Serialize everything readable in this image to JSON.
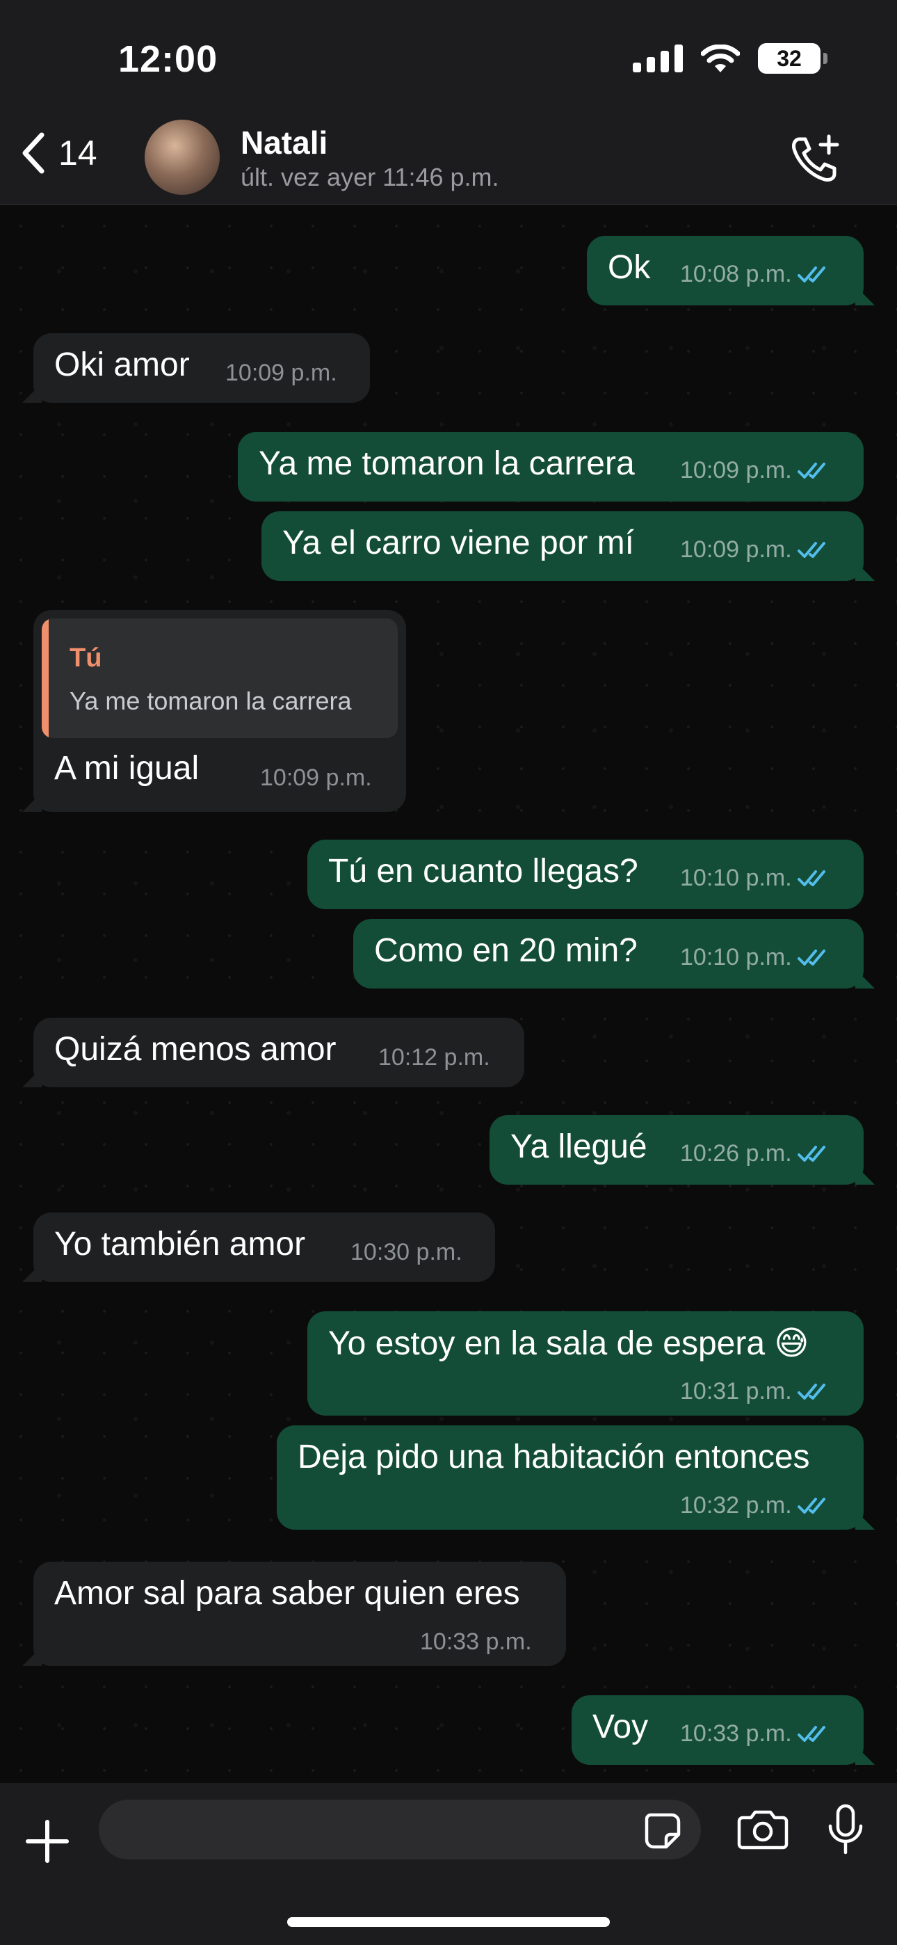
{
  "status_bar": {
    "time": "12:00",
    "battery": "32"
  },
  "header": {
    "back_count": "14",
    "contact_name": "Natali",
    "last_seen": "últ. vez ayer 11:46 p.m."
  },
  "messages": [
    {
      "direction": "out",
      "text": "Ok",
      "time": "10:08 p.m.",
      "read": true
    },
    {
      "direction": "in",
      "text": "Oki amor",
      "time": "10:09 p.m."
    },
    {
      "direction": "out",
      "text": "Ya me tomaron la carrera",
      "time": "10:09 p.m.",
      "read": true
    },
    {
      "direction": "out",
      "text": "Ya el carro viene por mí",
      "time": "10:09 p.m.",
      "read": true
    },
    {
      "direction": "in",
      "quote_author": "Tú",
      "quote_text": "Ya me tomaron la carrera",
      "text": "A mi igual",
      "time": "10:09 p.m."
    },
    {
      "direction": "out",
      "text": "Tú en cuanto llegas?",
      "time": "10:10 p.m.",
      "read": true
    },
    {
      "direction": "out",
      "text": "Como en 20 min?",
      "time": "10:10 p.m.",
      "read": true
    },
    {
      "direction": "in",
      "text": "Quizá menos amor",
      "time": "10:12 p.m."
    },
    {
      "direction": "out",
      "text": "Ya llegué",
      "time": "10:26 p.m.",
      "read": true
    },
    {
      "direction": "in",
      "text": "Yo también amor",
      "time": "10:30 p.m."
    },
    {
      "direction": "out",
      "text": "Yo estoy en la sala de espera 😅",
      "time": "10:31 p.m.",
      "read": true
    },
    {
      "direction": "out",
      "text": "Deja pido una habitación entonces",
      "time": "10:32 p.m.",
      "read": true
    },
    {
      "direction": "in",
      "text": "Amor sal para saber quien eres",
      "time": "10:33 p.m."
    },
    {
      "direction": "out",
      "text": "Voy",
      "time": "10:33 p.m.",
      "read": true
    }
  ],
  "composer": {
    "placeholder": ""
  },
  "colors": {
    "outgoing_bubble": "#134d37",
    "incoming_bubble": "#1f2021",
    "read_ticks": "#53bdeb",
    "quote_accent": "#ef8f6c"
  },
  "icons": [
    "chevron-left-icon",
    "call-add-icon",
    "plus-icon",
    "sticker-icon",
    "camera-icon",
    "mic-icon",
    "double-check-icon",
    "wifi-icon",
    "signal-icon"
  ]
}
